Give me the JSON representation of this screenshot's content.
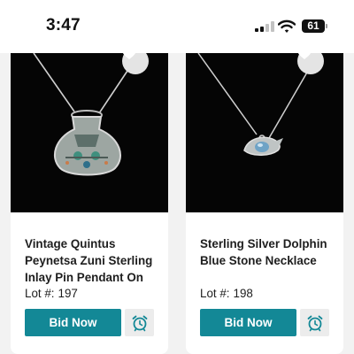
{
  "status": {
    "time": "3:47",
    "battery": "61"
  },
  "colors": {
    "accent": "#138896",
    "card_bg": "#ffffff",
    "page_bg": "#f2f2f2",
    "photo_bg": "#050505"
  },
  "lots": [
    {
      "title": "Vintage Quintus Peynetsa Zuni Sterling Inlay Pin Pendant On",
      "lot_label": "Lot #:",
      "lot_number": "197",
      "bid_label": "Bid Now",
      "photo_subject": "silver vase-shaped inlay pendant on chain",
      "icons": {
        "favorite": "heart-icon",
        "watch": "alarm-clock-icon"
      }
    },
    {
      "title": "Sterling Silver Dolphin Blue Stone Necklace",
      "lot_label": "Lot #:",
      "lot_number": "198",
      "bid_label": "Bid Now",
      "photo_subject": "silver dolphin pendant with blue stone on chain",
      "icons": {
        "favorite": "heart-icon",
        "watch": "alarm-clock-icon"
      }
    }
  ]
}
